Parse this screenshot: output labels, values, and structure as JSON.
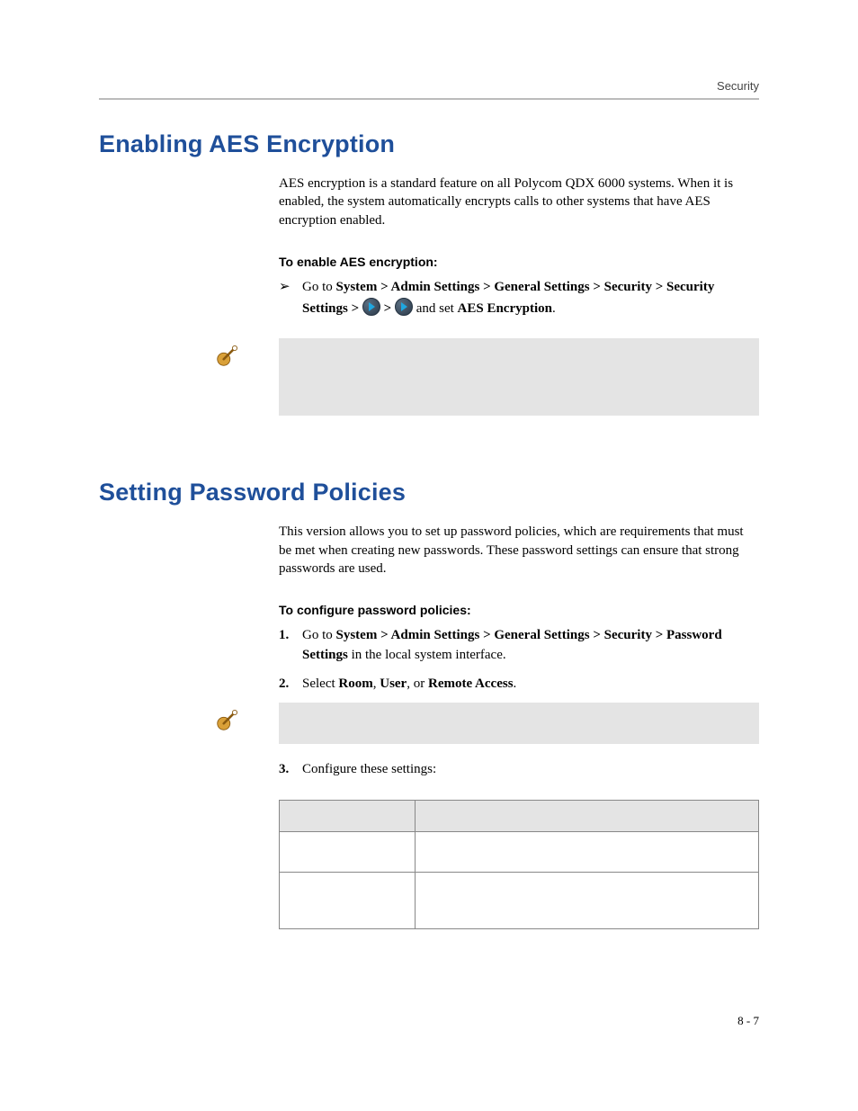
{
  "header": {
    "running_head": "Security"
  },
  "sections": {
    "aes": {
      "title": "Enabling AES Encryption",
      "intro": "AES encryption is a standard feature on all Polycom QDX 6000 systems. When it is enabled, the system automatically encrypts calls to other systems that have AES encryption enabled.",
      "subhead": "To enable AES encryption:",
      "step_bullet": "➢",
      "step_prefix": "Go to ",
      "step_path": "System > Admin Settings > General Settings > Security > Security Settings > ",
      "step_sep": " > ",
      "step_mid": " and set ",
      "step_target": "AES Encryption",
      "step_suffix": "."
    },
    "pwd": {
      "title": "Setting Password Policies",
      "intro": "This version allows you to set up password policies, which are requirements that must be met when creating new passwords. These password settings can ensure that strong passwords are used.",
      "subhead": "To configure password policies:",
      "steps": {
        "n1": "1.",
        "s1_prefix": "Go to ",
        "s1_path": "System > Admin Settings > General Settings > Security > Password Settings",
        "s1_suffix": " in the local system interface.",
        "n2": "2.",
        "s2_prefix": "Select ",
        "s2_a": "Room",
        "s2_c1": ", ",
        "s2_b": "User",
        "s2_c2": ", or ",
        "s2_c": "Remote Access",
        "s2_suffix": ".",
        "n3": "3.",
        "s3": "Configure these settings:"
      }
    }
  },
  "footer": {
    "page": "8 - 7"
  }
}
